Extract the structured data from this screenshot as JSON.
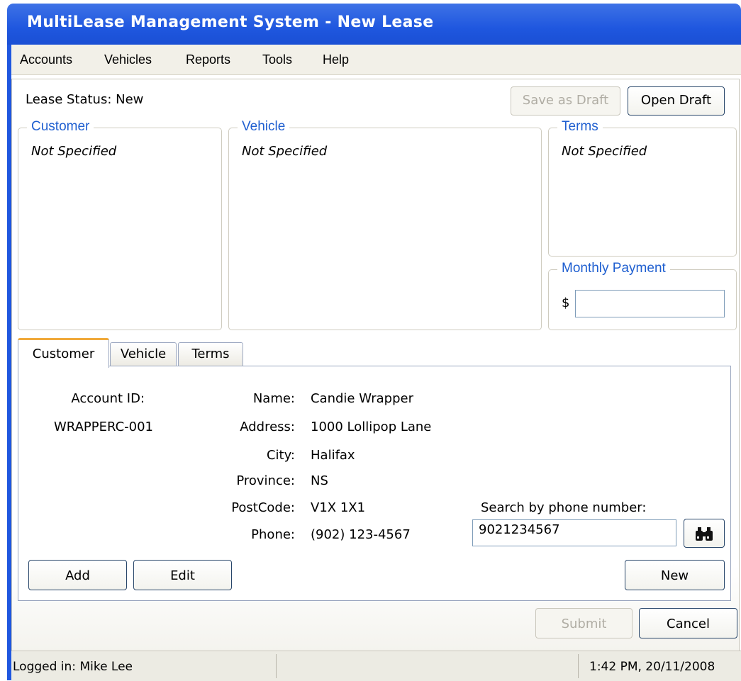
{
  "window": {
    "title": "MultiLease Management System - New Lease"
  },
  "menu": [
    "Accounts",
    "Vehicles",
    "Reports",
    "Tools",
    "Help"
  ],
  "lease_status": "Lease Status: New",
  "toolbar": {
    "save_draft": "Save as Draft",
    "open_draft": "Open Draft"
  },
  "groups": {
    "customer": {
      "title": "Customer",
      "value": "Not Specified"
    },
    "vehicle": {
      "title": "Vehicle",
      "value": "Not Specified"
    },
    "terms": {
      "title": "Terms",
      "value": "Not Specified"
    },
    "payment": {
      "title": "Monthly Payment",
      "currency": "$",
      "value": ""
    }
  },
  "tabs": [
    "Customer",
    "Vehicle",
    "Terms"
  ],
  "customer_tab": {
    "account_id_label": "Account ID:",
    "account_id": "WRAPPERC-001",
    "fields": [
      {
        "label": "Name:",
        "value": "Candie Wrapper"
      },
      {
        "label": "Address:",
        "value": "1000 Lollipop Lane"
      },
      {
        "label": "City:",
        "value": "Halifax"
      },
      {
        "label": "Province:",
        "value": "NS"
      },
      {
        "label": "PostCode:",
        "value": "V1X 1X1"
      },
      {
        "label": "Phone:",
        "value": "(902) 123-4567"
      }
    ],
    "search_label": "Search by phone number:",
    "search_value": "9021234567",
    "add": "Add",
    "edit": "Edit",
    "new": "New"
  },
  "actions": {
    "submit": "Submit",
    "cancel": "Cancel"
  },
  "statusbar": {
    "user": "Logged in: Mike Lee",
    "datetime": "1:42 PM, 20/11/2008"
  },
  "colors": {
    "title_bar": "#1f57df",
    "legend_text": "#1f5fd0",
    "active_tab_accent": "#f0a93a"
  }
}
